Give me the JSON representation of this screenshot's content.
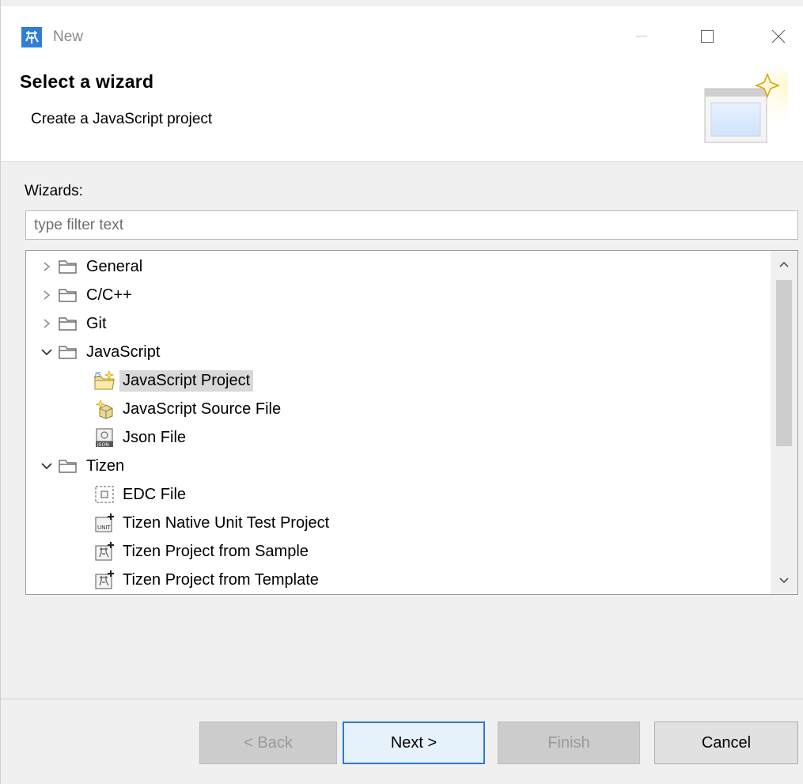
{
  "window": {
    "title": "New",
    "controls": [
      "minimize-icon",
      "maximize-icon",
      "close-icon"
    ]
  },
  "header": {
    "title": "Select a wizard",
    "subtitle": "Create a JavaScript project",
    "banner_icon": "new-wizard-banner-icon"
  },
  "wizards": {
    "label": "Wizards:",
    "filter_placeholder": "type filter text",
    "filter_value": ""
  },
  "tree": {
    "items": [
      {
        "label": "General",
        "level": 0,
        "expanded": false,
        "icon": "folder-icon"
      },
      {
        "label": "C/C++",
        "level": 0,
        "expanded": false,
        "icon": "folder-icon"
      },
      {
        "label": "Git",
        "level": 0,
        "expanded": false,
        "icon": "folder-icon"
      },
      {
        "label": "JavaScript",
        "level": 0,
        "expanded": true,
        "icon": "folder-icon"
      },
      {
        "label": "JavaScript Project",
        "level": 1,
        "selected": true,
        "icon": "js-project-icon"
      },
      {
        "label": "JavaScript Source File",
        "level": 1,
        "icon": "js-source-file-icon"
      },
      {
        "label": "Json File",
        "level": 1,
        "icon": "json-file-icon"
      },
      {
        "label": "Tizen",
        "level": 0,
        "expanded": true,
        "icon": "folder-icon"
      },
      {
        "label": "EDC File",
        "level": 1,
        "icon": "edc-file-icon"
      },
      {
        "label": "Tizen Native Unit Test Project",
        "level": 1,
        "icon": "unit-test-project-icon"
      },
      {
        "label": "Tizen Project from Sample",
        "level": 1,
        "icon": "tizen-sample-project-icon"
      },
      {
        "label": "Tizen Project from Template",
        "level": 1,
        "icon": "tizen-template-project-icon"
      }
    ]
  },
  "buttons": {
    "back": "< Back",
    "next": "Next >",
    "finish": "Finish",
    "cancel": "Cancel"
  },
  "colors": {
    "accent": "#2b7bd0",
    "selection": "#d9d9d9",
    "disabled_text": "#9a9a9a"
  }
}
